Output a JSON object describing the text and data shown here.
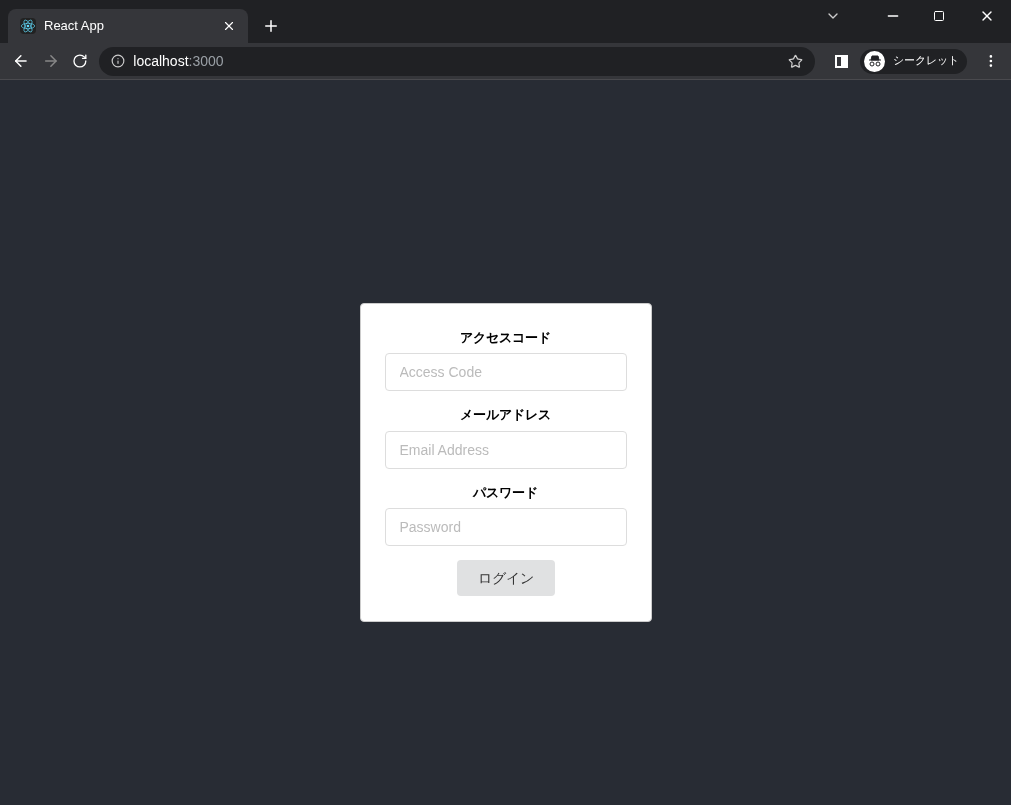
{
  "browser": {
    "tab": {
      "title": "React App"
    },
    "address": {
      "host": "localhost",
      "port": ":3000"
    },
    "profile": {
      "label": "シークレット"
    }
  },
  "form": {
    "fields": [
      {
        "label": "アクセスコード",
        "placeholder": "Access Code"
      },
      {
        "label": "メールアドレス",
        "placeholder": "Email Address"
      },
      {
        "label": "パスワード",
        "placeholder": "Password"
      }
    ],
    "button": "ログイン"
  }
}
